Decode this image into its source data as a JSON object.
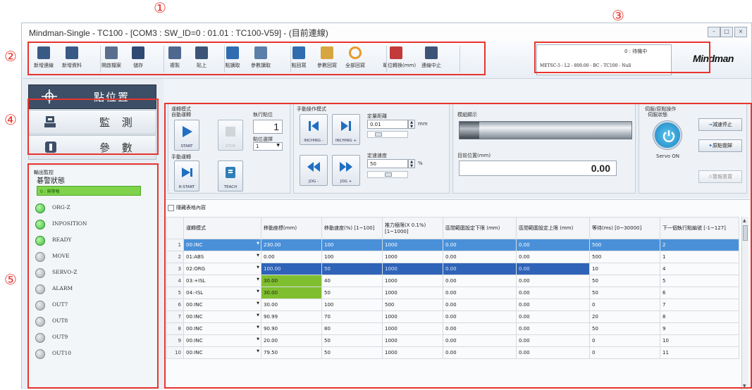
{
  "markers": {
    "m1": "①",
    "m2": "②",
    "m3": "③",
    "m4": "④",
    "m5": "⑤",
    "m6": "⑥"
  },
  "window": {
    "title": "Mindman-Single - TC100 - [COM3 : SW_ID=0 : 01.01 : TC100-V59] - (目前連線)"
  },
  "toolbar": [
    {
      "label": "新增連線",
      "icon": "new-connection-icon"
    },
    {
      "label": "新增資料",
      "icon": "new-data-icon"
    },
    {
      "label": "開啟檔案",
      "icon": "open-folder-icon"
    },
    {
      "label": "儲存",
      "icon": "save-icon"
    },
    {
      "label": "複製",
      "icon": "copy-icon"
    },
    {
      "label": "貼上",
      "icon": "paste-icon"
    },
    {
      "label": "點讀取",
      "icon": "point-read-icon"
    },
    {
      "label": "參數讀取",
      "icon": "param-read-icon"
    },
    {
      "label": "點回寫",
      "icon": "point-write-icon"
    },
    {
      "label": "參數回寫",
      "icon": "param-write-icon"
    },
    {
      "label": "全部回寫",
      "icon": "write-all-icon"
    },
    {
      "label": "單位轉換(mm)",
      "icon": "unit-convert-icon"
    },
    {
      "label": "連線中止",
      "icon": "disconnect-icon"
    }
  ],
  "status": {
    "state": "0 : 待機中",
    "model": "METSC-5 - L2 - 800.00 - BC - TC100 - Null",
    "brand": "Mindman"
  },
  "nav": [
    {
      "label": "點位置",
      "icon": "crosshair-icon"
    },
    {
      "label": "監 測",
      "icon": "monitor-icon"
    },
    {
      "label": "參 數",
      "icon": "parameter-icon"
    }
  ],
  "monitor": {
    "section_title": "輸出監控",
    "alarm_title": "碁警狀態",
    "alarm_state": "0 : 無警報",
    "indicators": [
      {
        "label": "ORG-Z",
        "on": true
      },
      {
        "label": "INPOSITION",
        "on": true
      },
      {
        "label": "READY",
        "on": true
      },
      {
        "label": "MOVE",
        "on": false
      },
      {
        "label": "SERVO-Z",
        "on": false
      },
      {
        "label": "ALARM",
        "on": false
      },
      {
        "label": "OUT7",
        "on": false
      },
      {
        "label": "OUT8",
        "on": false
      },
      {
        "label": "OUT9",
        "on": false
      },
      {
        "label": "OUT10",
        "on": false
      }
    ]
  },
  "op": {
    "mode_title": "運轉模式",
    "auto_title": "自動運轉",
    "exec_pos_label": "執行點位",
    "exec_pos_value": "1",
    "pos_select_label": "點位選擇",
    "pos_select_value": "1",
    "start": "START",
    "stop": "STOP",
    "manual_title": "手動運轉",
    "rstart": "R-START",
    "teach": "TEACH",
    "jog_title": "手動操作模式",
    "inching_minus": "INCHING -",
    "inching_plus": "INCHING +",
    "fixed_dist_label": "定量距離",
    "fixed_dist_value": "0.01",
    "fixed_dist_unit": "mm",
    "jog_minus": "JOG -",
    "jog_plus": "JOG +",
    "speed_label": "定速速度",
    "speed_value": "50",
    "speed_unit": "%",
    "model_display": "模組顯示",
    "cur_pos_label": "目前位置(mm)",
    "cur_pos_value": "0.00",
    "servo_title": "伺服/原點操作",
    "servo_state": "伺服狀態",
    "servo_on": "Servo ON",
    "decel_stop": "減速停止",
    "home_return": "原點復歸",
    "alarm_reset": "警報重置"
  },
  "table": {
    "checkbox_label": "隱藏表格內容",
    "headers": [
      "",
      "運轉模式",
      "移動座標(mm)",
      "移動速度(%) [1~100]",
      "推力極限(X 0.1%) [1~1000]",
      "區間範圍設定下限 (mm)",
      "區間範圍設定上限 (mm)",
      "等待(ms) [0~30000]",
      "下一個執行點編號 [-1~127]"
    ],
    "rows": [
      [
        "1",
        "00:INC",
        "230.00",
        "100",
        "1000",
        "0.00",
        "0.00",
        "500",
        "2"
      ],
      [
        "2",
        "01:ABS",
        "0.00",
        "100",
        "1000",
        "0.00",
        "0.00",
        "500",
        "1"
      ],
      [
        "3",
        "02:ORG",
        "100.00",
        "50",
        "1000",
        "0.00",
        "0.00",
        "10",
        "4"
      ],
      [
        "4",
        "03:+ISL",
        "30.00",
        "40",
        "1000",
        "0.00",
        "0.00",
        "50",
        "5"
      ],
      [
        "5",
        "04:-ISL",
        "30.00",
        "50",
        "1000",
        "0.00",
        "0.00",
        "50",
        "6"
      ],
      [
        "6",
        "00:INC",
        "30.00",
        "100",
        "500",
        "0.00",
        "0.00",
        "0",
        "7"
      ],
      [
        "7",
        "00:INC",
        "90.99",
        "70",
        "1000",
        "0.00",
        "0.00",
        "20",
        "8"
      ],
      [
        "8",
        "00:INC",
        "90.90",
        "80",
        "1000",
        "0.00",
        "0.00",
        "50",
        "9"
      ],
      [
        "9",
        "00:INC",
        "20.00",
        "50",
        "1000",
        "0.00",
        "0.00",
        "0",
        "10"
      ],
      [
        "10",
        "00:INC",
        "79.50",
        "50",
        "1000",
        "0.00",
        "0.00",
        "0",
        "11"
      ]
    ]
  },
  "colors": {
    "accent": "#e8342e",
    "nav_bg": "#3d4f66",
    "selected_row": "#4a90d9",
    "green_cell": "#7fbf2f",
    "led_on": "#3fbf3f",
    "led_off": "#a6a9ad"
  }
}
